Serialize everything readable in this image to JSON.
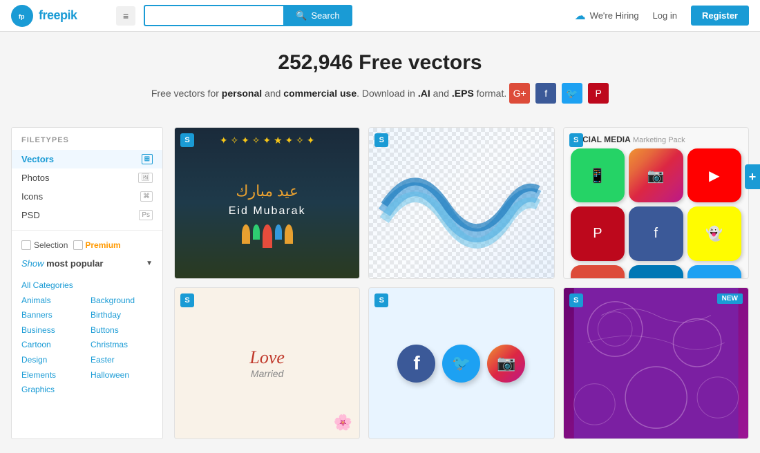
{
  "header": {
    "logo_text": "freepik",
    "menu_icon": "≡",
    "search_placeholder": "",
    "search_button_label": "Search",
    "search_icon": "🔍",
    "hiring_label": "We're Hiring",
    "login_label": "Log in",
    "register_label": "Register"
  },
  "hero": {
    "title": "252,946 Free vectors",
    "description_prefix": "Free vectors for",
    "personal": "personal",
    "and": "and",
    "commercial": "commercial use",
    "description_mid": ". Download in",
    "ai": ".AI",
    "and2": "and",
    "eps": ".EPS",
    "description_suffix": "format.",
    "social": {
      "google": "G+",
      "facebook": "f",
      "twitter": "t",
      "pinterest": "P"
    }
  },
  "sidebar": {
    "filetypes_label": "FILETYPES",
    "items": [
      {
        "label": "Vectors",
        "icon": "⊞",
        "active": true
      },
      {
        "label": "Photos",
        "icon": "🖼",
        "active": false
      },
      {
        "label": "Icons",
        "icon": "⌘",
        "active": false
      },
      {
        "label": "PSD",
        "icon": "Ps",
        "active": false
      }
    ],
    "selection_label": "Selection",
    "premium_label": "Premium",
    "show_label": "Show",
    "most_popular": "most popular",
    "categories": {
      "header": "All Categories",
      "left": [
        "Animals",
        "Banners",
        "Business",
        "Cartoon",
        "Design Elements",
        "Graphics"
      ],
      "right": [
        "Background",
        "Birthday",
        "Buttons",
        "Christmas",
        "Easter",
        "Halloween"
      ]
    }
  },
  "grid": {
    "items": [
      {
        "id": "eid",
        "type": "eid",
        "title": "Eid Mubarak",
        "s_badge": "S"
      },
      {
        "id": "wave",
        "type": "wave",
        "title": "Wave abstract",
        "s_badge": "S"
      },
      {
        "id": "social",
        "type": "social",
        "title": "SOCIAL MEDIA Marketing Pack",
        "s_badge": "S"
      },
      {
        "id": "love",
        "type": "love",
        "title": "Love Married",
        "s_badge": "S"
      },
      {
        "id": "fbsocial",
        "type": "fbsocial",
        "title": "Social icons",
        "s_badge": "S"
      },
      {
        "id": "purple",
        "type": "purple",
        "title": "Purple pattern",
        "s_badge": "S",
        "new_badge": "NEW"
      }
    ]
  },
  "expand": {
    "icon": "+"
  }
}
